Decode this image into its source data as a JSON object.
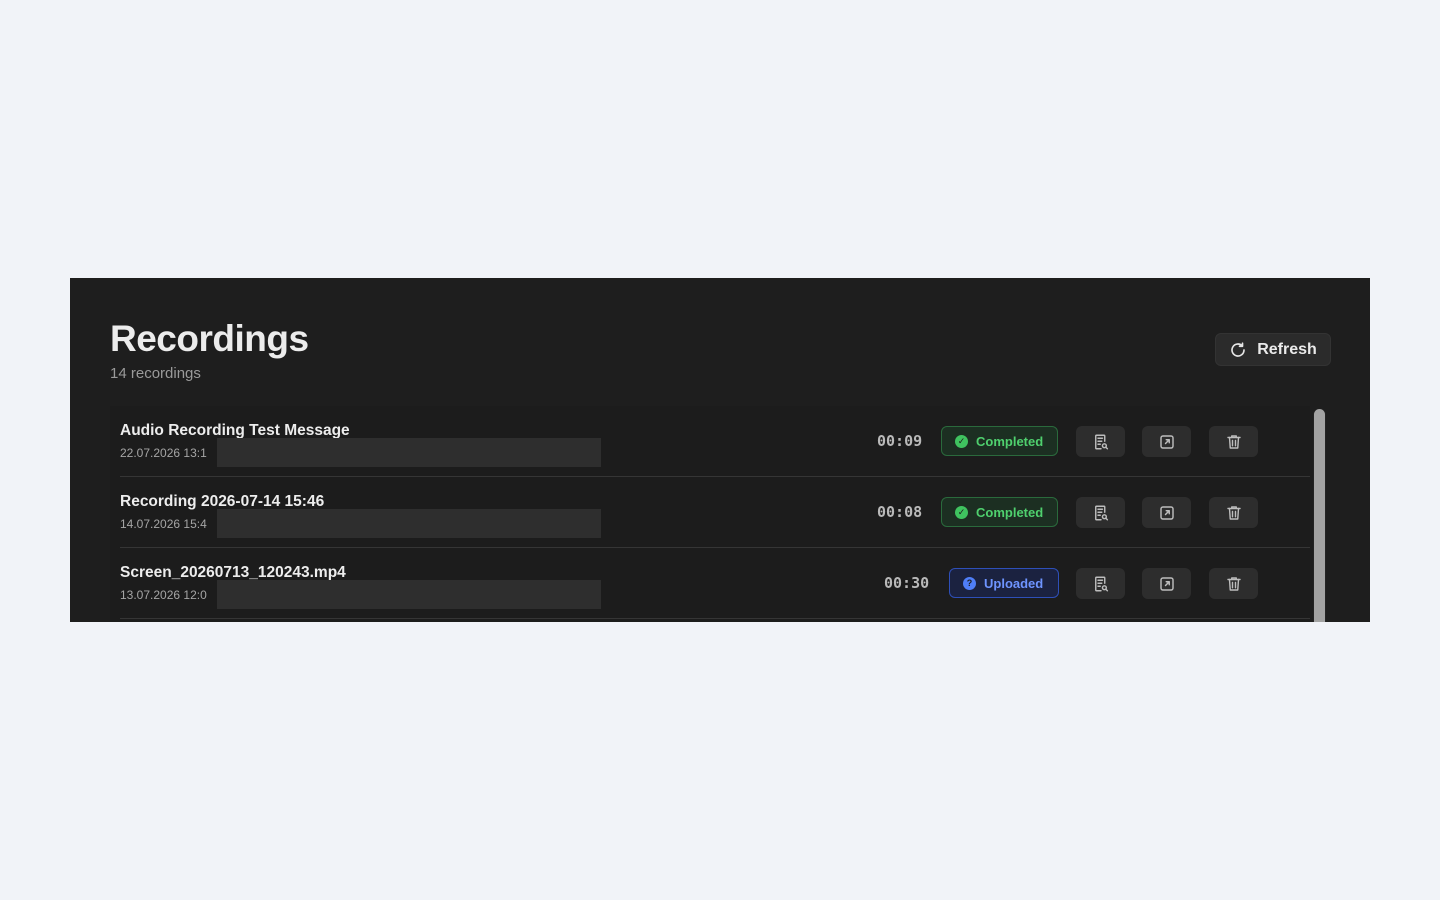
{
  "header": {
    "title": "Recordings",
    "subtitle": "14 recordings",
    "refresh_label": "Refresh",
    "refresh_icon": "refresh-icon"
  },
  "recordings": [
    {
      "name": "Audio Recording Test Message",
      "date": "22.07.2026 13:1",
      "duration": "00:09",
      "status": "Completed",
      "status_color": "#3fc35f",
      "status_icon": "check-circle-icon"
    },
    {
      "name": "Recording 2026-07-14 15:46",
      "date": "14.07.2026 15:4",
      "duration": "00:08",
      "status": "Completed",
      "status_color": "#3fc35f",
      "status_icon": "check-circle-icon"
    },
    {
      "name": "Screen_20260713_120243.mp4",
      "date": "13.07.2026 12:0",
      "duration": "00:30",
      "status": "Uploaded",
      "status_color": "#4f7ef7",
      "status_icon": "info-circle-icon"
    }
  ],
  "row_actions": [
    "transcript-icon",
    "open-external-icon",
    "trash-icon"
  ]
}
